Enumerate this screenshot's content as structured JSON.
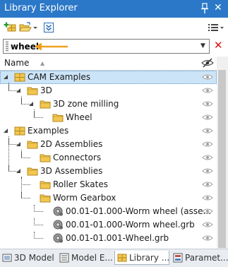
{
  "window": {
    "title": "Library Explorer",
    "pin_icon": "pin-icon",
    "close_glyph": "✕"
  },
  "toolbar": {
    "icons": [
      "add-library-icon",
      "open-folder-icon",
      "dropdown-arrow-icon",
      "collapse-all-icon",
      "view-options-icon"
    ]
  },
  "search": {
    "value": "wheel",
    "placeholder": "",
    "clear_glyph": "✕",
    "dropdown_glyph": "▼"
  },
  "annotation": {
    "arrow_color": "#f0a020"
  },
  "columns": {
    "name": "Name"
  },
  "tree": [
    {
      "label": "CAM Examples",
      "depth": 0,
      "expanded": true,
      "icon": "library-icon",
      "selected": true
    },
    {
      "label": "3D",
      "depth": 1,
      "expanded": true,
      "icon": "folder-icon"
    },
    {
      "label": "3D zone milling",
      "depth": 2,
      "expanded": true,
      "icon": "folder-icon"
    },
    {
      "label": "Wheel",
      "depth": 3,
      "icon": "folder-icon"
    },
    {
      "label": "Examples",
      "depth": 0,
      "expanded": true,
      "icon": "library-icon"
    },
    {
      "label": "2D Assemblies",
      "depth": 1,
      "expanded": true,
      "icon": "folder-icon"
    },
    {
      "label": "Connectors",
      "depth": 2,
      "icon": "folder-icon"
    },
    {
      "label": "3D Assemblies",
      "depth": 1,
      "expanded": true,
      "icon": "folder-icon"
    },
    {
      "label": "Roller Skates",
      "depth": 2,
      "icon": "folder-icon"
    },
    {
      "label": "Worm Gearbox",
      "depth": 2,
      "icon": "folder-icon"
    },
    {
      "label": "00.01-01.000-Worm wheel (asse...",
      "depth": 3,
      "icon": "part-file-icon"
    },
    {
      "label": "00.01-01.000-Worm wheel.grb",
      "depth": 3,
      "icon": "part-file-icon"
    },
    {
      "label": "00.01-01.001-Wheel.grb",
      "depth": 3,
      "icon": "part-file-icon"
    }
  ],
  "bottom_tabs": [
    {
      "label": "3D Model",
      "icon": "3d-model-icon"
    },
    {
      "label": "Model E...",
      "icon": "model-explorer-icon"
    },
    {
      "label": "Library ...",
      "icon": "library-explorer-icon",
      "active": true
    },
    {
      "label": "Paramet...",
      "icon": "parameters-icon"
    }
  ],
  "colors": {
    "title_bar": "#2b78c8",
    "selection": "#cce4f7",
    "folder": "#f3c64f",
    "clear": "#dd1111"
  }
}
